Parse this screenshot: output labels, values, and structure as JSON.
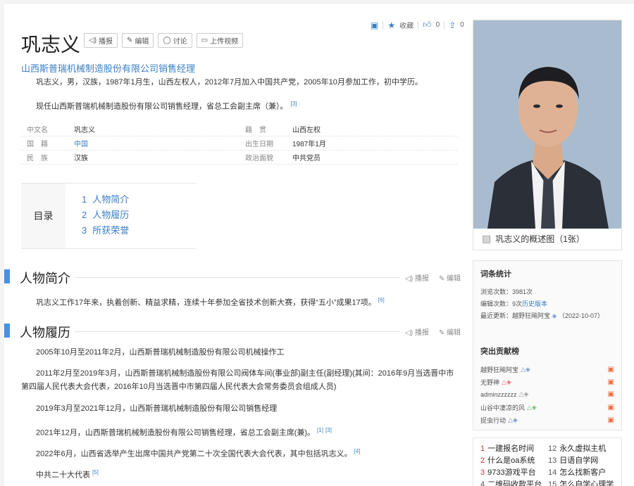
{
  "header": {
    "title": "巩志义",
    "actions": [
      "播报",
      "编辑",
      "讨论",
      "上传视频"
    ],
    "subtitle": "山西斯普瑞机械制造股份有限公司销售经理",
    "tools": {
      "collect": "收藏",
      "like_count": "0",
      "share_count": "0"
    }
  },
  "intro": {
    "p1": "巩志义，男，汉族，1987年1月生，山西左权人，2012年7月加入中国共产党，2005年10月参加工作，初中学历。",
    "p2": "现任山西斯普瑞机械制造股份有限公司销售经理，省总工会副主席（兼）。",
    "p2_ref": "[3]"
  },
  "basic_info": [
    {
      "k1": "中文名",
      "v1": "巩志义",
      "k2": "籍　贯",
      "v2": "山西左权"
    },
    {
      "k1": "国　籍",
      "v1": "中国",
      "k2": "出生日期",
      "v2": "1987年1月"
    },
    {
      "k1": "民　族",
      "v1": "汉族",
      "k2": "政治面貌",
      "v2": "中共党员"
    }
  ],
  "toc": {
    "label": "目录",
    "items": [
      {
        "n": "1",
        "t": "人物简介"
      },
      {
        "n": "2",
        "t": "人物履历"
      },
      {
        "n": "3",
        "t": "所获荣誉"
      }
    ]
  },
  "section_ops": {
    "play": "播报",
    "edit": "编辑"
  },
  "sections": {
    "s1": {
      "title": "人物简介",
      "p": "巩志义工作17年来，执着创新、精益求精，连续十年参加全省技术创新大赛，获得“五小”成果17项。",
      "ref": "[6]"
    },
    "s2": {
      "title": "人物履历",
      "p1": "2005年10月至2011年2月，山西斯普瑞机械制造股份有限公司机械操作工",
      "p2": "2011年2月至2019年3月，山西斯普瑞机械制造股份有限公司阀体车间(事业部)副主任(副经理)(其间：2016年9月当选晋中市第四届人民代表大会代表，2016年10月当选晋中市第四届人民代表大会常务委员会组成人员)",
      "p3": "2019年3月至2021年12月，山西斯普瑞机械制造股份有限公司销售经理",
      "p4": "2021年12月，山西斯普瑞机械制造股份有限公司销售经理，省总工会副主席(兼)。",
      "p4_refs": [
        "[1]",
        "[3]"
      ],
      "p5": "2022年6月，山西省选举产生出席中国共产党第二十次全国代表大会代表，其中包括巩志义。",
      "p5_ref": "[4]",
      "p6": "中共二十大代表",
      "p6_ref": "[5]"
    }
  },
  "photo": {
    "caption": "巩志义的概述图（1张）"
  },
  "stats": {
    "title": "词条统计",
    "views": "浏览次数：3981次",
    "edits_prefix": "编辑次数：9次",
    "edits_link": "历史版本",
    "updated_prefix": "最近更新：",
    "updated_user": "越野狂飚阿宝",
    "updated_date": "（2022-10-07）",
    "contrib_title": "突出贡献榜",
    "contributors": [
      "越野狂飚阿宝",
      "无野神",
      "adminzzzzzz",
      "山谷中凄凉的风",
      "捉虫行动"
    ]
  },
  "hot": [
    {
      "n": "1",
      "t": "一建报名时间"
    },
    {
      "n": "12",
      "t": "永久虚拟主机"
    },
    {
      "n": "2",
      "t": "什么是oa系统"
    },
    {
      "n": "13",
      "t": "日语自学网"
    },
    {
      "n": "3",
      "t": "9733游戏平台"
    },
    {
      "n": "14",
      "t": "怎么找新客户"
    },
    {
      "n": "4",
      "t": "二维码收款平台"
    },
    {
      "n": "15",
      "t": "怎么自学心理学"
    }
  ],
  "colors": {
    "accent": "#3a7fc5",
    "section_bar": "#4a90e2",
    "flag": "#f06a3a"
  }
}
